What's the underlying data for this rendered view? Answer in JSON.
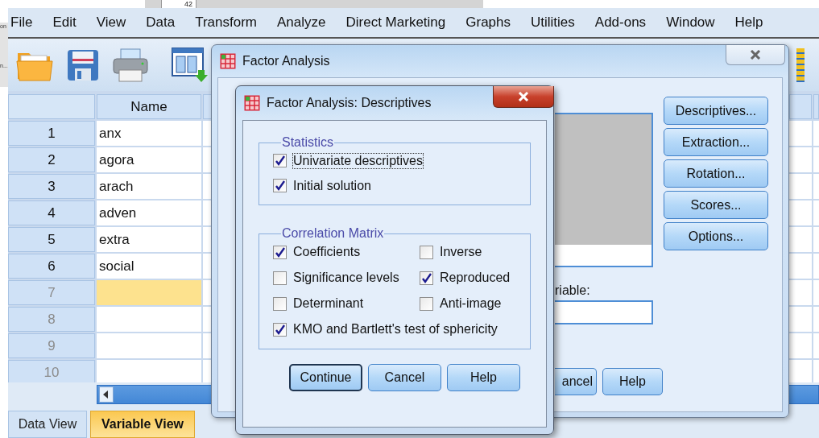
{
  "background_window": {
    "cell_text": "42",
    "edge_texts": [
      "on",
      "n..."
    ]
  },
  "menu": [
    "File",
    "Edit",
    "View",
    "Data",
    "Transform",
    "Analyze",
    "Direct Marketing",
    "Graphs",
    "Utilities",
    "Add-ons",
    "Window",
    "Help"
  ],
  "data_editor": {
    "columns": [
      "Name"
    ],
    "rows": [
      {
        "number": "1",
        "name": "anx",
        "selected": false,
        "disabled": false
      },
      {
        "number": "2",
        "name": "agora",
        "selected": false,
        "disabled": false
      },
      {
        "number": "3",
        "name": "arach",
        "selected": false,
        "disabled": false
      },
      {
        "number": "4",
        "name": "adven",
        "selected": false,
        "disabled": false
      },
      {
        "number": "5",
        "name": "extra",
        "selected": false,
        "disabled": false
      },
      {
        "number": "6",
        "name": "social",
        "selected": false,
        "disabled": false
      },
      {
        "number": "7",
        "name": "",
        "selected": true,
        "disabled": true
      },
      {
        "number": "8",
        "name": "",
        "selected": false,
        "disabled": true
      },
      {
        "number": "9",
        "name": "",
        "selected": false,
        "disabled": true
      },
      {
        "number": "10",
        "name": "",
        "selected": false,
        "disabled": true
      }
    ]
  },
  "view_tabs": [
    {
      "label": "Data View",
      "selected": false
    },
    {
      "label": "Variable View",
      "selected": true
    }
  ],
  "factor_dialog": {
    "title": "Factor Analysis",
    "side_buttons": [
      "Descriptives...",
      "Extraction...",
      "Rotation...",
      "Scores...",
      "Options..."
    ],
    "target_label": "riable:",
    "bottom_buttons": [
      "ancel",
      "Help"
    ]
  },
  "descriptives_dialog": {
    "title": "Factor Analysis: Descriptives",
    "groups": [
      {
        "title": "Statistics",
        "rows": [
          {
            "options": [
              {
                "label": "Univariate descriptives",
                "checked": true,
                "focused": true
              }
            ]
          },
          {
            "options": [
              {
                "label": "Initial solution",
                "checked": true,
                "focused": false
              }
            ]
          }
        ]
      },
      {
        "title": "Correlation Matrix",
        "rows": [
          {
            "options": [
              {
                "label": "Coefficients",
                "checked": true,
                "focused": false
              },
              {
                "label": "Inverse",
                "checked": false,
                "focused": false
              }
            ]
          },
          {
            "options": [
              {
                "label": "Significance levels",
                "checked": false,
                "focused": false
              },
              {
                "label": "Reproduced",
                "checked": true,
                "focused": false
              }
            ]
          },
          {
            "options": [
              {
                "label": "Determinant",
                "checked": false,
                "focused": false
              },
              {
                "label": "Anti-image",
                "checked": false,
                "focused": false
              }
            ]
          },
          {
            "options": [
              {
                "label": "KMO and Bartlett's test of sphericity",
                "checked": true,
                "focused": false
              }
            ]
          }
        ]
      }
    ],
    "buttons": [
      {
        "label": "Continue",
        "default": true
      },
      {
        "label": "Cancel",
        "default": false
      },
      {
        "label": "Help",
        "default": false
      }
    ]
  }
}
